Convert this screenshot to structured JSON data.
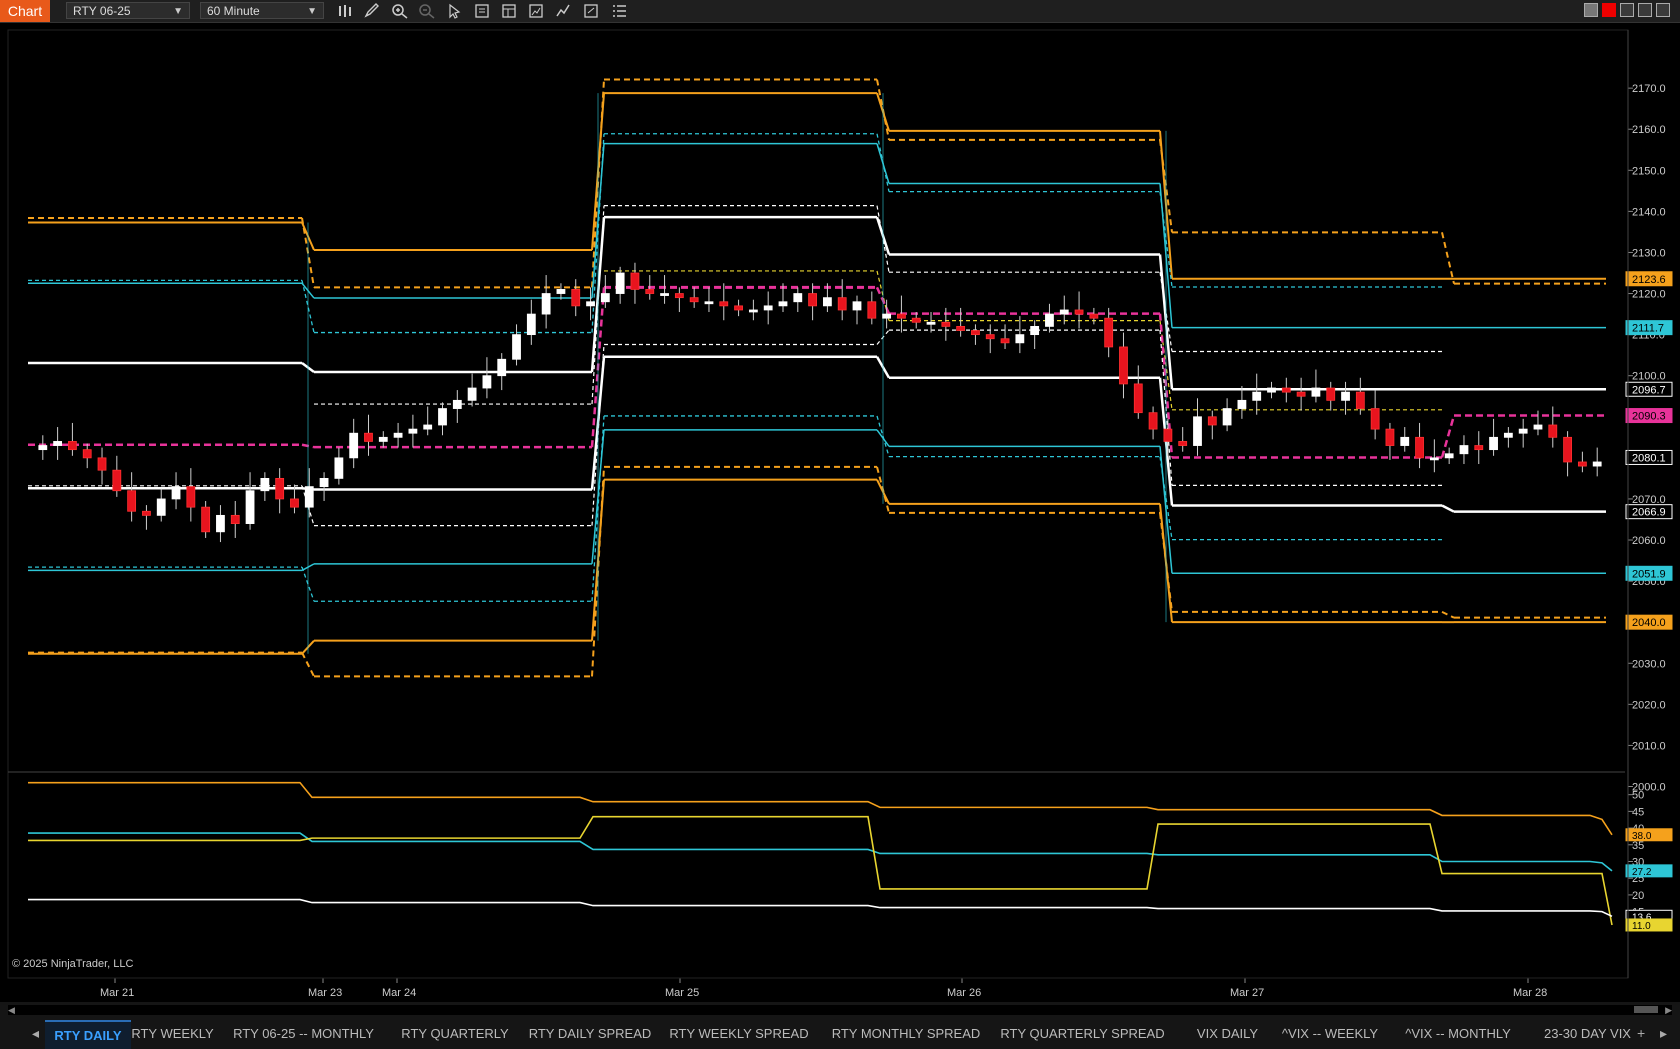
{
  "toolbar": {
    "chart_tab": "Chart",
    "instrument": "RTY 06-25",
    "interval": "60 Minute"
  },
  "copyright": "© 2025 NinjaTrader, LLC",
  "tabs": [
    {
      "label": "RTY DAILY",
      "active": true
    },
    {
      "label": "RTY WEEKLY",
      "active": false
    },
    {
      "label": "RTY 06-25 -- MONTHLY",
      "active": false
    },
    {
      "label": "RTY QUARTERLY",
      "active": false
    },
    {
      "label": "RTY DAILY SPREAD",
      "active": false
    },
    {
      "label": "RTY WEEKLY SPREAD",
      "active": false
    },
    {
      "label": "RTY MONTHLY SPREAD",
      "active": false
    },
    {
      "label": "RTY QUARTERLY SPREAD",
      "active": false
    },
    {
      "label": "VIX DAILY",
      "active": false
    },
    {
      "label": "^VIX -- WEEKLY",
      "active": false
    },
    {
      "label": "^VIX -- MONTHLY",
      "active": false
    },
    {
      "label": "23-30 DAY VIX",
      "active": false
    }
  ],
  "colors": {
    "orange": "#f5a11c",
    "cyan": "#2ec6d6",
    "white": "#ffffff",
    "magenta": "#e8339a",
    "yellow": "#e8d530",
    "up": "#ffffff",
    "down": "#e8141e",
    "bg": "#000000"
  },
  "chart_data": [
    {
      "type": "candlestick",
      "x_labels": [
        "Mar 21",
        "Mar 23",
        "Mar 24",
        "Mar 25",
        "Mar 26",
        "Mar 27",
        "Mar 28"
      ],
      "ylim": [
        2000,
        2175
      ],
      "y_ticks": [
        2000,
        2010,
        2020,
        2030,
        2040,
        2050,
        2060,
        2070,
        2080,
        2090,
        2100,
        2110,
        2120,
        2130,
        2140,
        2150,
        2160,
        2170
      ],
      "price_flags": [
        {
          "value": 2123.6,
          "label": "2123.6",
          "color": "#f5a11c"
        },
        {
          "value": 2111.7,
          "label": "2111.7",
          "color": "#2ec6d6"
        },
        {
          "value": 2096.7,
          "label": "2096.7",
          "color": "#ffffff"
        },
        {
          "value": 2090.3,
          "label": "2090.3",
          "color": "#e8339a"
        },
        {
          "value": 2080.1,
          "label": "2080.1",
          "color": "#ffffff"
        },
        {
          "value": 2066.9,
          "label": "2066.9",
          "color": "#ffffff"
        },
        {
          "value": 2051.9,
          "label": "2051.9",
          "color": "#2ec6d6"
        },
        {
          "value": 2040.0,
          "label": "2040.0",
          "color": "#f5a11c"
        }
      ],
      "levels": [
        {
          "day": "Mar 21",
          "orange_hi": 2137.3,
          "orange_hi_dash": 2138.4,
          "cyan_hi": 2122.5,
          "cyan_hi_dash": 2123.2,
          "white_hi": 2103.1,
          "pivot": 2083.2,
          "white_lo": 2072.6,
          "white_lo_dash": 2073.2,
          "cyan_lo": 2052.6,
          "cyan_lo_dash": 2053.4,
          "orange_lo": 2032.3,
          "orange_lo_dash": 2032.6
        },
        {
          "day": "Mar 23",
          "orange_hi": 2130.6,
          "orange_hi_dash": 2121.5,
          "cyan_hi": 2118.9,
          "cyan_hi_dash": 2110.5,
          "white_hi": 2100.9,
          "white_hi_dash": 2093.1,
          "pivot": 2082.6,
          "white_lo": 2072.3,
          "white_lo_dash": 2063.5,
          "cyan_lo": 2054.2,
          "cyan_lo_dash": 2045.1,
          "orange_lo": 2035.5,
          "orange_lo_dash": 2026.8
        },
        {
          "day": "Mar 25",
          "orange_hi": 2168.8,
          "orange_hi_dash": 2172.1,
          "cyan_hi": 2156.5,
          "cyan_hi_dash": 2158.9,
          "white_hi": 2138.6,
          "white_hi_dash": 2141.4,
          "yellow": 2125.5,
          "pivot": 2121.5,
          "white_lo": 2104.6,
          "white_lo_dash": 2107.6,
          "cyan_lo": 2086.8,
          "cyan_lo_dash": 2090.2,
          "orange_lo": 2074.7,
          "orange_lo_dash": 2077.8
        },
        {
          "day": "Mar 26",
          "orange_hi": 2159.6,
          "orange_hi_dash": 2157.4,
          "cyan_hi": 2146.8,
          "cyan_hi_dash": 2144.8,
          "white_hi": 2129.5,
          "white_hi_dash": 2125.2,
          "yellow": 2113.4,
          "pivot": 2115.1,
          "white_lo": 2099.5,
          "white_lo_dash": 2111.1,
          "cyan_lo": 2082.8,
          "cyan_lo_dash": 2080.3,
          "orange_lo": 2068.8,
          "orange_lo_dash": 2066.6
        },
        {
          "day": "Mar 27",
          "orange_hi": 2123.6,
          "orange_hi_dash": 2134.9,
          "cyan_hi": 2111.7,
          "cyan_hi_dash": 2121.6,
          "white_hi": 2096.7,
          "white_hi_dash": 2105.9,
          "yellow": 2091.7,
          "pivot": 2080.1,
          "white_lo": 2068.4,
          "white_lo_dash": 2073.3,
          "cyan_lo": 2051.9,
          "cyan_lo_dash": 2060.1,
          "orange_lo": 2040.0,
          "orange_lo_dash": 2042.5
        },
        {
          "day": "Mar 28",
          "orange_hi": 2123.6,
          "orange_hi_dash": 2122.4,
          "cyan_hi": 2111.7,
          "white_hi": 2096.7,
          "pivot": 2090.3,
          "white_lo": 2066.9,
          "cyan_lo": 2051.9,
          "orange_lo": 2040.0,
          "orange_lo_dash": 2041.1
        }
      ]
    },
    {
      "type": "line",
      "ylim": [
        8,
        57
      ],
      "y_ticks": [
        15,
        20,
        25,
        30,
        35,
        40,
        45,
        50
      ],
      "price_flags": [
        {
          "value": 38.0,
          "label": "38.0",
          "color": "#f5a11c"
        },
        {
          "value": 27.2,
          "label": "27.2",
          "color": "#2ec6d6"
        },
        {
          "value": 13.6,
          "label": "13.6",
          "color": "#ffffff"
        },
        {
          "value": 11.0,
          "label": "11.0",
          "color": "#e8d530"
        }
      ],
      "series": [
        {
          "color": "#f5a11c",
          "values": [
            53.6,
            53.6,
            49.2,
            49.2,
            47.9,
            47.9,
            46.2,
            46.2,
            45.5,
            45.5,
            43.8,
            43.8,
            42.6,
            38.0
          ]
        },
        {
          "color": "#2ec6d6",
          "values": [
            38.5,
            38.5,
            36.0,
            36.0,
            33.6,
            33.6,
            32.4,
            32.4,
            32.0,
            32.0,
            30.0,
            30.0,
            29.6,
            27.2
          ]
        },
        {
          "color": "#e8d530",
          "values": [
            36.3,
            36.3,
            37.0,
            37.0,
            43.4,
            43.4,
            21.8,
            21.8,
            41.2,
            41.2,
            26.4,
            26.4,
            26.4,
            11.0
          ]
        },
        {
          "color": "#ffffff",
          "values": [
            18.6,
            18.6,
            17.7,
            17.7,
            16.8,
            16.8,
            16.2,
            16.2,
            15.9,
            15.9,
            15.2,
            15.2,
            15.0,
            13.6
          ]
        }
      ]
    }
  ]
}
